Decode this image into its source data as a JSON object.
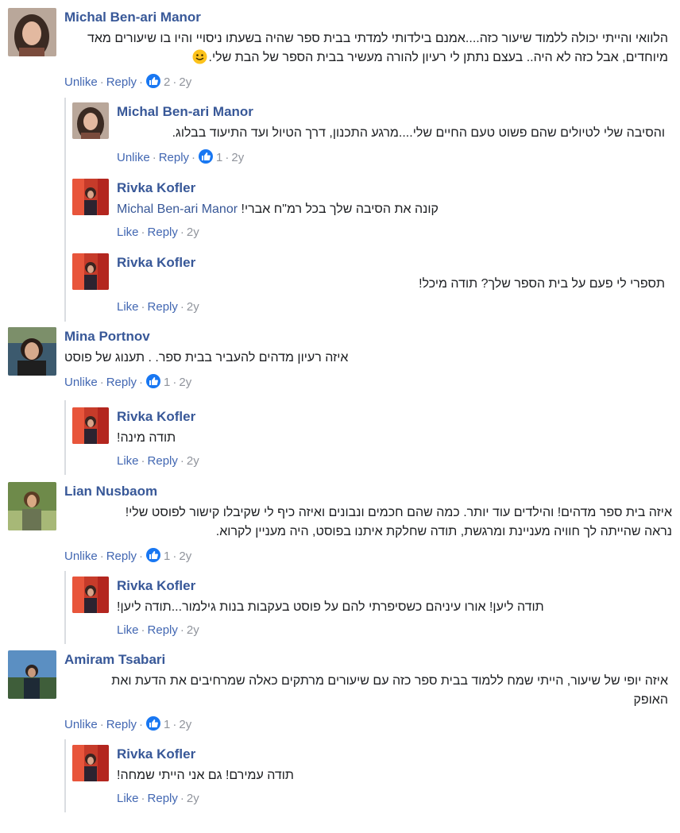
{
  "comments": [
    {
      "author": "Michal Ben-ari Manor",
      "lines": [
        "הלוואי והייתי יכולה ללמוד שיעור כזה....אמנם בילדותי למדתי בבית ספר שהיה בשעתו ניסויי והיו בו שיעורים מאד",
        "מיוחדים, אבל כזה לא היה.. בעצם נתתן לי רעיון להורה מעשיר בבית הספר של הבת שלי."
      ],
      "has_smiley": true,
      "actions": {
        "primary": "Unlike",
        "reply": "Reply",
        "likes": "2",
        "time": "2y"
      }
    },
    {
      "author": "Michal Ben-ari Manor",
      "lines": [
        "והסיבה שלי לטיולים שהם פשוט טעם החיים שלי....מרגע התכנון, דרך הטיול ועד התיעוד בבלוג."
      ],
      "actions": {
        "primary": "Unlike",
        "reply": "Reply",
        "likes": "1",
        "time": "2y"
      }
    },
    {
      "author": "Rivka Kofler",
      "mention": "Michal Ben-ari Manor",
      "lines": [
        "קונה את הסיבה שלך בכל רמ\"ח אברי!"
      ],
      "actions": {
        "primary": "Like",
        "reply": "Reply",
        "time": "2y"
      }
    },
    {
      "author": "Rivka Kofler",
      "lines": [
        "תספרי לי פעם על בית הספר שלך? תודה מיכל!"
      ],
      "actions": {
        "primary": "Like",
        "reply": "Reply",
        "time": "2y"
      }
    },
    {
      "author": "Mina Portnov",
      "lines": [
        "איזה רעיון מדהים להעביר בבית ספר. . תענוג של פוסט"
      ],
      "actions": {
        "primary": "Unlike",
        "reply": "Reply",
        "likes": "1",
        "time": "2y"
      }
    },
    {
      "author": "Rivka Kofler",
      "lines": [
        "תודה מינה!"
      ],
      "actions": {
        "primary": "Like",
        "reply": "Reply",
        "time": "2y"
      }
    },
    {
      "author": "Lian Nusbaom",
      "lines": [
        "איזה בית ספר מדהים! והילדים עוד יותר. כמה שהם חכמים ונבונים ואיזה כיף לי שקיבלו קישור לפוסט שלי!",
        "נראה שהייתה לך חוויה מעניינת ומרגשת, תודה שחלקת איתנו בפוסט, היה מעניין לקרוא."
      ],
      "actions": {
        "primary": "Unlike",
        "reply": "Reply",
        "likes": "1",
        "time": "2y"
      }
    },
    {
      "author": "Rivka Kofler",
      "lines": [
        "תודה ליען! אורו עיניהם כשסיפרתי להם על פוסט בעקבות בנות גילמור...תודה ליען!"
      ],
      "actions": {
        "primary": "Like",
        "reply": "Reply",
        "time": "2y"
      }
    },
    {
      "author": "Amiram Tsabari",
      "lines": [
        "איזה יופי של שיעור, הייתי שמח ללמוד בבית ספר כזה עם שיעורים מרתקים כאלה שמרחיבים את הדעת ואת",
        "האופק"
      ],
      "actions": {
        "primary": "Unlike",
        "reply": "Reply",
        "likes": "1",
        "time": "2y"
      }
    },
    {
      "author": "Rivka Kofler",
      "lines": [
        "תודה עמירם! גם אני הייתי שמחה!"
      ],
      "actions": {
        "primary": "Like",
        "reply": "Reply",
        "time": "2y"
      }
    }
  ],
  "colors": {
    "link": "#385898",
    "action": "#4267b2",
    "meta": "#90949c",
    "like_badge": "#1877f2"
  }
}
